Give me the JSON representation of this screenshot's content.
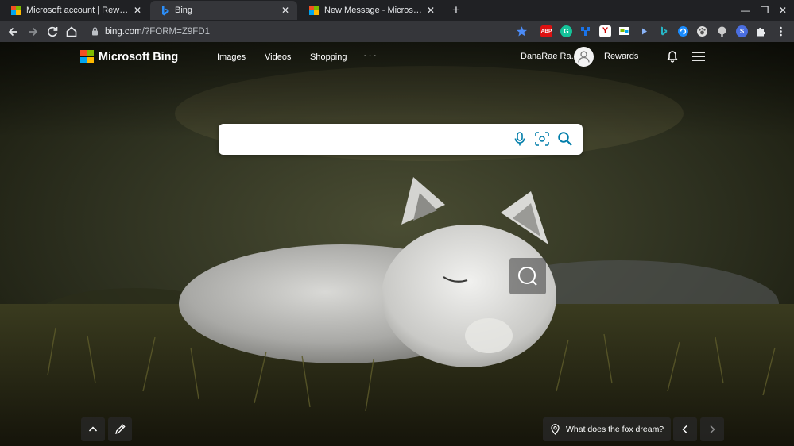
{
  "browser": {
    "tabs": [
      {
        "title": "Microsoft account | Rewards Dashboard",
        "favicon": "microsoft-logo-icon",
        "active": false
      },
      {
        "title": "Bing",
        "favicon": "bing-logo-icon",
        "active": true
      },
      {
        "title": "New Message - Microsoft Tech Community",
        "favicon": "microsoft-logo-icon",
        "active": false
      }
    ],
    "url_host": "bing.com",
    "url_path": "/?FORM=Z9FD1",
    "extensions": [
      "abp-icon",
      "grammarly-icon",
      "tree-icon",
      "y-icon",
      "screenshot-icon",
      "play-icon",
      "bing-icon",
      "circle-icon",
      "paw-icon",
      "balloon-icon",
      "s-icon",
      "puzzle-icon"
    ],
    "ext_labels": {
      "abp": "ABP",
      "grammarly": "G",
      "y": "Y",
      "s": "S"
    }
  },
  "header": {
    "brand": "Microsoft Bing",
    "nav": [
      {
        "label": "Images"
      },
      {
        "label": "Videos"
      },
      {
        "label": "Shopping"
      }
    ],
    "more": "···",
    "user_name": "DanaRae Ra...",
    "rewards_label": "Rewards"
  },
  "search": {
    "value": "",
    "placeholder": ""
  },
  "image_caption": "What does the fox dream?",
  "colors": {
    "ms_red": "#f25022",
    "ms_green": "#7fba00",
    "ms_blue": "#00a4ef",
    "ms_yellow": "#ffb900",
    "search_icon_teal": "#007daa",
    "bookmark_star": "#4c8bf5"
  }
}
